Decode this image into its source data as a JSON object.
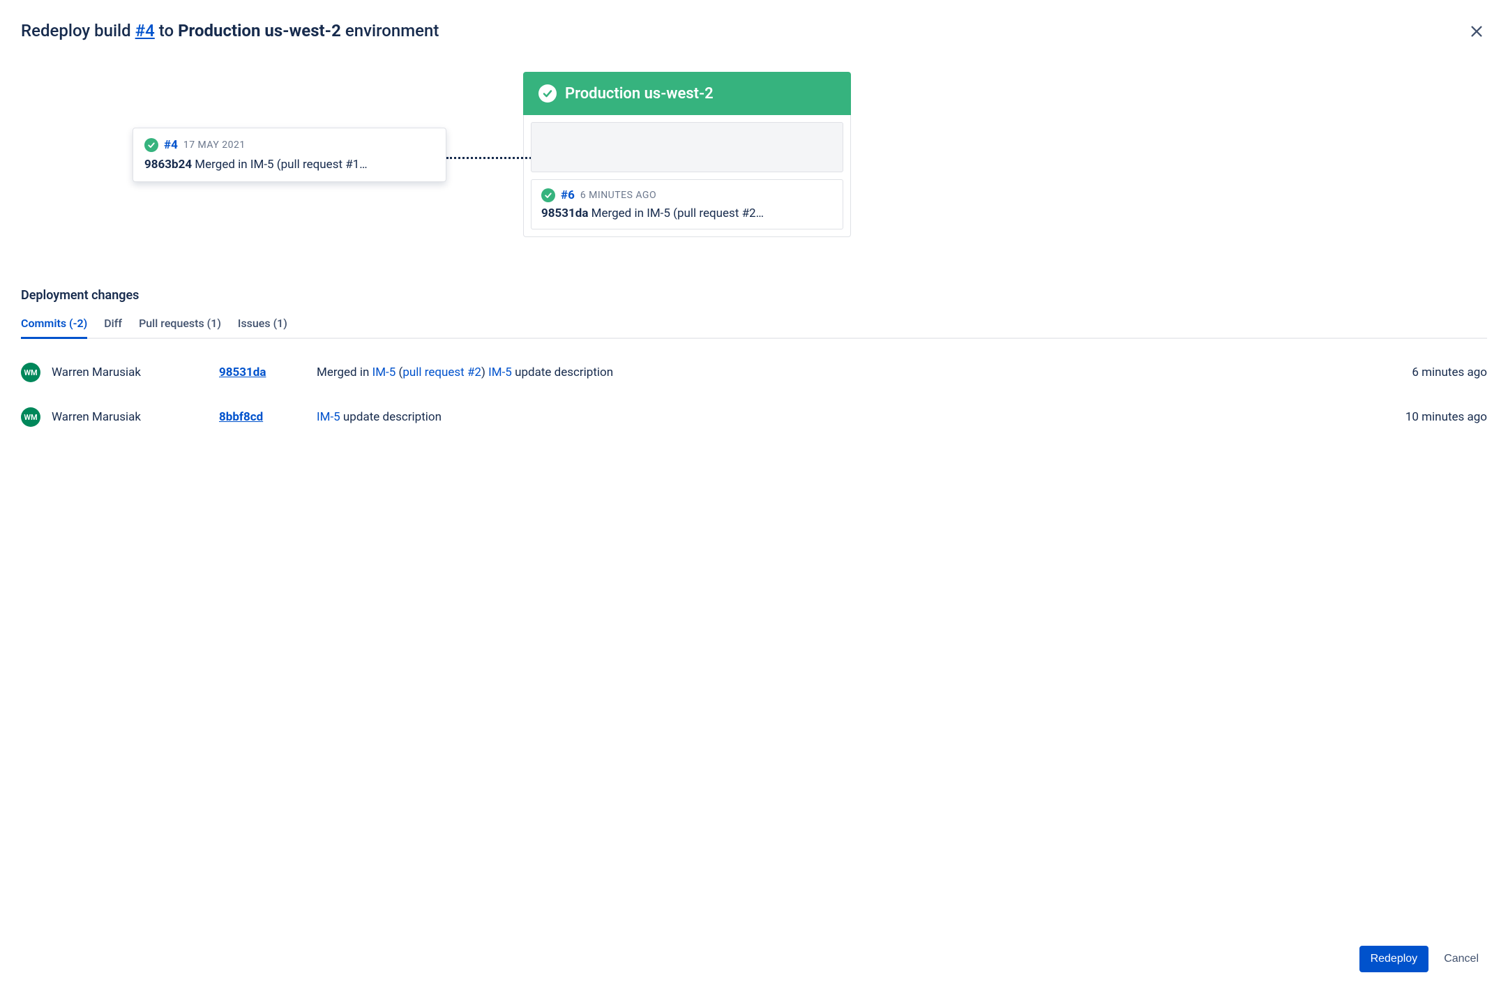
{
  "header": {
    "prefix": "Redeploy build ",
    "build_link": "#4",
    "mid": " to ",
    "env_name": "Production us-west-2",
    "suffix": " environment"
  },
  "source_build": {
    "number": "#4",
    "date": "17 MAY 2021",
    "hash": "9863b24",
    "message": " Merged in IM-5 (pull request #1…"
  },
  "environment": {
    "name": "Production us-west-2",
    "current": {
      "number": "#6",
      "date": "6 MINUTES AGO",
      "hash": "98531da",
      "message": " Merged in IM-5 (pull request #2…"
    }
  },
  "section_title": "Deployment changes",
  "tabs": {
    "commits": "Commits (-2)",
    "diff": "Diff",
    "pull_requests": "Pull requests (1)",
    "issues": "Issues (1)"
  },
  "commits": [
    {
      "initials": "WM",
      "author": "Warren Marusiak",
      "hash": "98531da",
      "msg_prefix": "Merged in ",
      "msg_link1": "IM-5",
      "msg_mid1": " (",
      "msg_link2": "pull request #2",
      "msg_mid2": ") ",
      "msg_link3": "IM-5",
      "msg_suffix": " update description",
      "time": "6 minutes ago"
    },
    {
      "initials": "WM",
      "author": "Warren Marusiak",
      "hash": "8bbf8cd",
      "msg_prefix": "",
      "msg_link1": "IM-5",
      "msg_mid1": "",
      "msg_link2": "",
      "msg_mid2": "",
      "msg_link3": "",
      "msg_suffix": " update description",
      "time": "10 minutes ago"
    }
  ],
  "footer": {
    "primary": "Redeploy",
    "cancel": "Cancel"
  }
}
